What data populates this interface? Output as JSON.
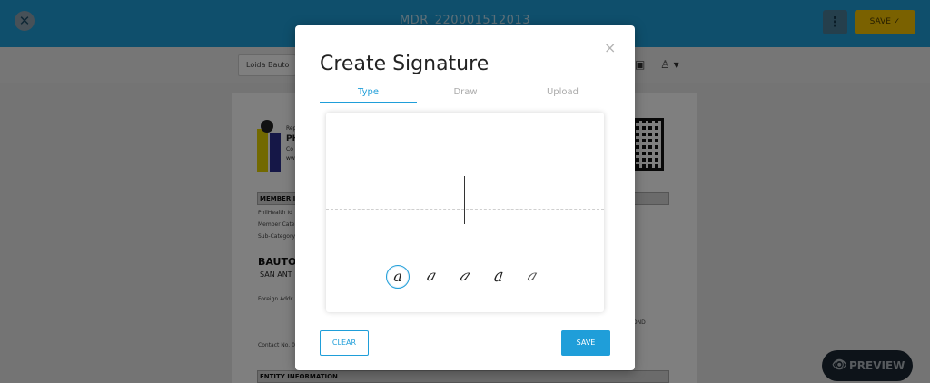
{
  "header": {
    "close_icon_glyph": "✕",
    "doc_title": "MDR_220001512013",
    "menu_glyph": "⋮",
    "save_label": "SAVE ✓"
  },
  "toolbar": {
    "signer": "Loida Bauto",
    "image_icon": "image-icon",
    "image_glyph": "▣",
    "person_icon": "person-stamp-icon",
    "person_glyph": "♙ ▾"
  },
  "document": {
    "org_small": "Rep",
    "org_name": "PH",
    "org_line": "Co",
    "org_line2": "ww",
    "section_member": "MEMBER I",
    "line_pin": "PhilHealth Id",
    "line_category": "Member Cate",
    "line_subcategory": "Sub-Category",
    "member_name": "BAUTO,",
    "member_address": "SAN ANT",
    "foreign_address": "Foreign Addr",
    "contact": "Contact No. 0",
    "right_text": "DND",
    "section_entity": "ENTITY INFORMATION"
  },
  "preview": {
    "label": "PREVIEW",
    "icon": "eye-icon",
    "glyph": "👁"
  },
  "modal": {
    "close_glyph": "×",
    "title": "Create Signature",
    "tabs": [
      {
        "label": "Type",
        "active": true
      },
      {
        "label": "Draw",
        "active": false
      },
      {
        "label": "Upload",
        "active": false
      }
    ],
    "font_options": [
      "a",
      "a",
      "a",
      "a",
      "a"
    ],
    "selected_font_index": 0,
    "clear_label": "CLEAR",
    "save_label": "SAVE"
  },
  "colors": {
    "accent": "#1f9ed9",
    "save_yellow": "#f5c300",
    "preview_dark": "#1a2632"
  }
}
